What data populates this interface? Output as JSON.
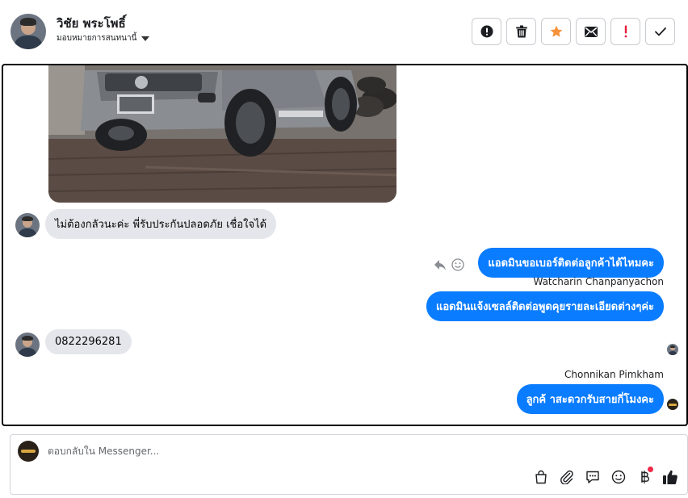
{
  "header": {
    "contact_name": "วิชัย พระโพธิ์",
    "assign_label": "มอบหมายการสนทนานี้"
  },
  "actions": [
    {
      "name": "spam-button",
      "icon": "alert-circle-icon"
    },
    {
      "name": "delete-button",
      "icon": "trash-icon"
    },
    {
      "name": "star-button",
      "icon": "star-icon",
      "color": "#f7923a"
    },
    {
      "name": "mark-unread-button",
      "icon": "envelope-icon"
    },
    {
      "name": "follow-up-button",
      "icon": "exclamation-icon",
      "color": "#e41e3f"
    },
    {
      "name": "done-button",
      "icon": "check-icon"
    }
  ],
  "messages": {
    "incoming_1": "ไม่ต้องกลัวนะค่ะ พี่รับประกันปลอดภัย เชื่อใจได้",
    "outgoing_1": "แอดมินขอเบอร์ติดต่อลูกค้าได้ไหมคะ",
    "sender_1": "Watcharin Chanpanyachon",
    "outgoing_2": "แอดมินแจ้งเซลล์ติดต่อพูดคุยรายละเอียดต่างๆค่ะ",
    "incoming_2": "0822296281",
    "sender_2": "Chonnikan Pimkham",
    "outgoing_3": "ลูกค้ าสะดวกรับสายกี่โมงคะ"
  },
  "composer": {
    "placeholder": "ตอบกลับใน Messenger..."
  },
  "colors": {
    "outgoing_bubble": "#0a7cff",
    "incoming_bubble": "#e4e6eb",
    "accent_star": "#f7923a",
    "accent_alert": "#e41e3f",
    "notification_dot": "#f02849"
  }
}
